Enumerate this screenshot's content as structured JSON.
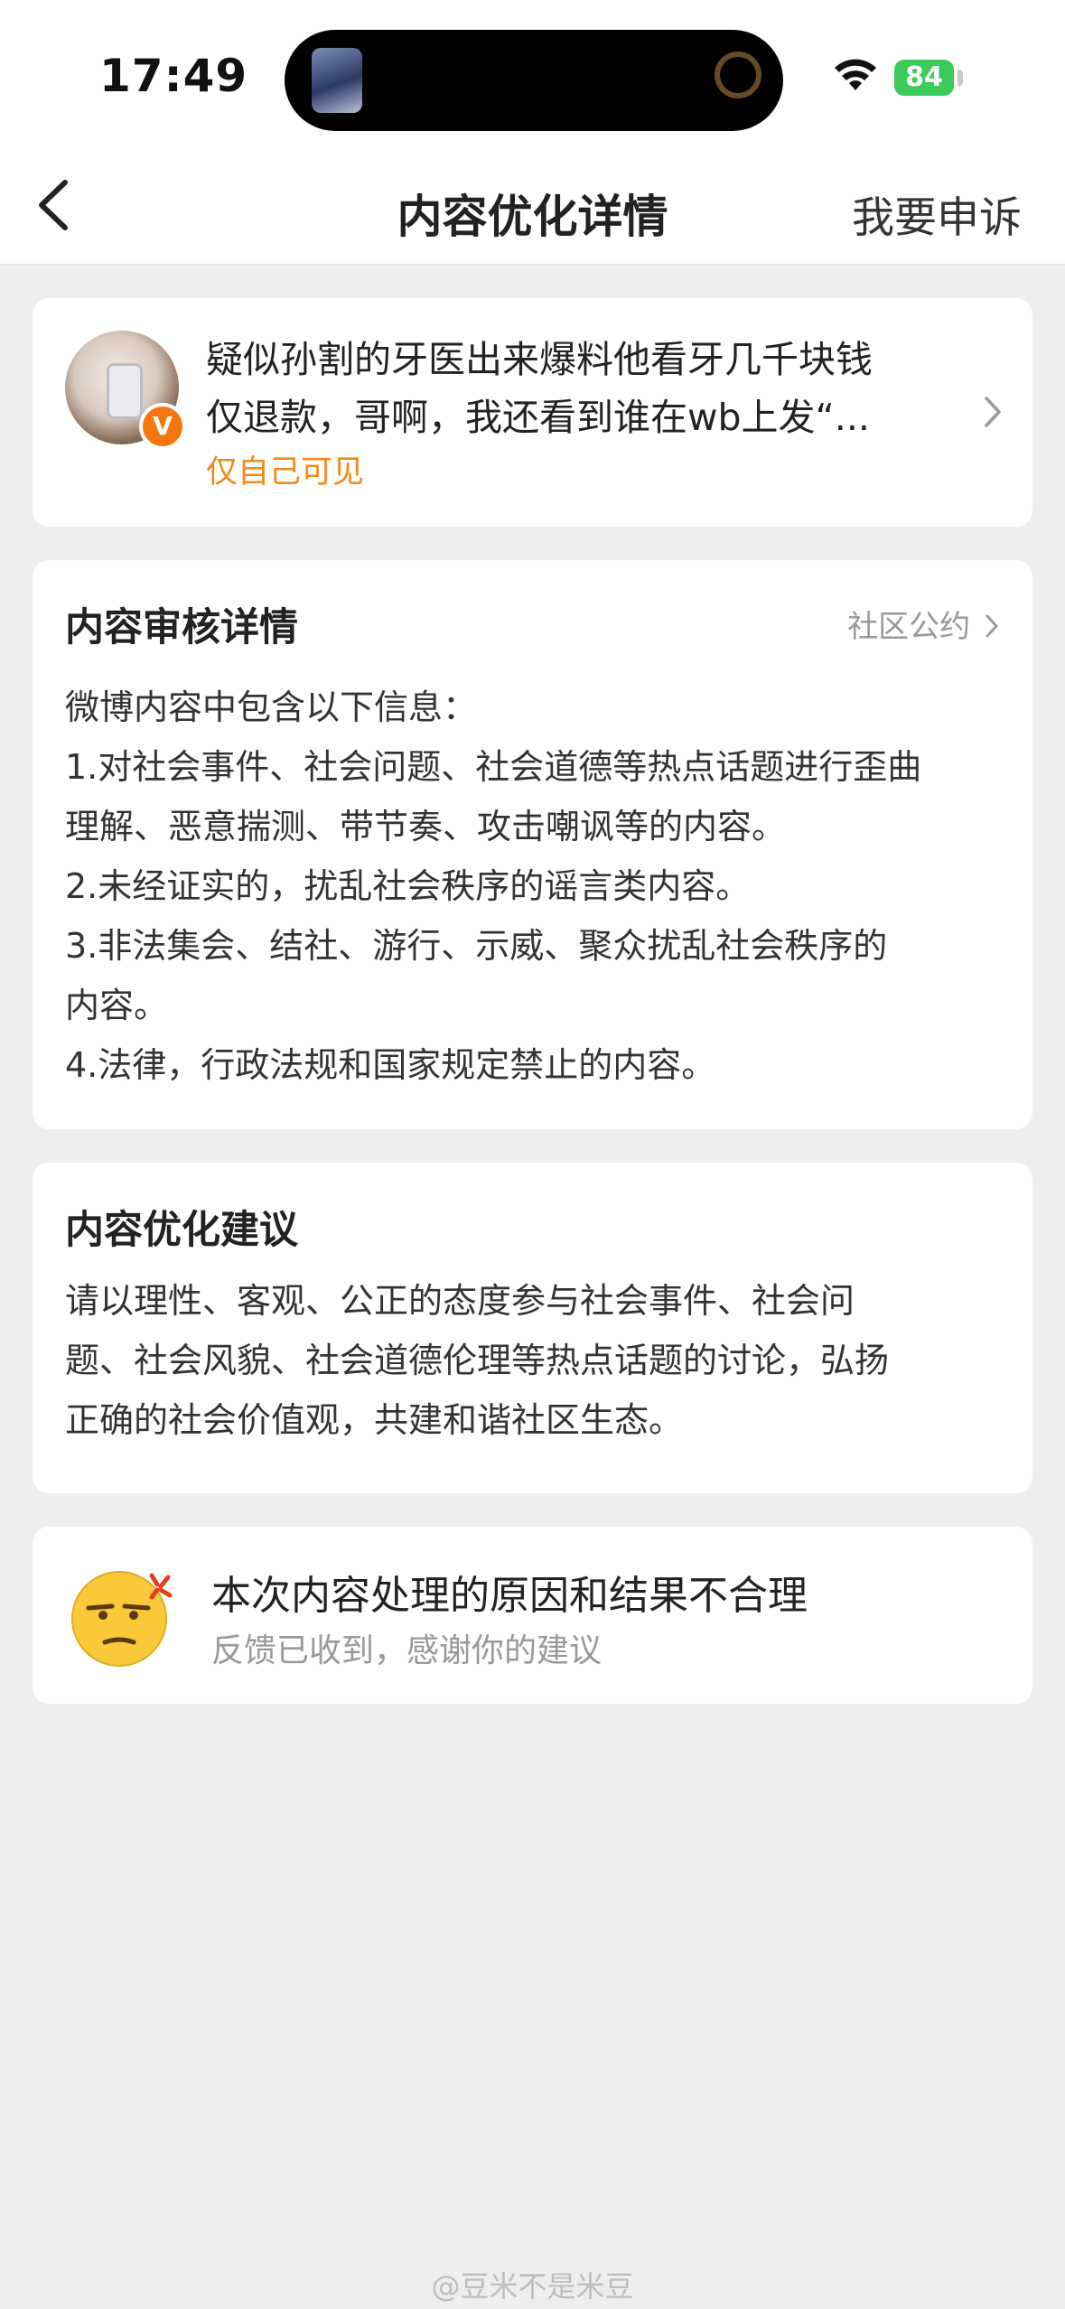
{
  "status_bar": {
    "time": "17:49",
    "battery": "84"
  },
  "nav": {
    "title": "内容优化详情",
    "appeal": "我要申诉"
  },
  "post": {
    "line1": "疑似孙割的牙医出来爆料他看牙几千块钱",
    "line2": "仅退款，哥啊，我还看到谁在wb上发“...",
    "visibility": "仅自己可见",
    "badge": "V"
  },
  "review": {
    "title": "内容审核详情",
    "rules_link": "社区公约",
    "lines": [
      "微博内容中包含以下信息：",
      "1.对社会事件、社会问题、社会道德等热点话题进行歪曲",
      "理解、恶意揣测、带节奏、攻击嘲讽等的内容。",
      "2.未经证实的，扰乱社会秩序的谣言类内容。",
      "3.非法集会、结社、游行、示威、聚众扰乱社会秩序的",
      "内容。",
      "4.法律，行政法规和国家规定禁止的内容。"
    ]
  },
  "advice": {
    "title": "内容优化建议",
    "lines": [
      "请以理性、客观、公正的态度参与社会事件、社会问",
      "题、社会风貌、社会道德伦理等热点话题的讨论，弘扬",
      "正确的社会价值观，共建和谐社区生态。"
    ]
  },
  "feedback": {
    "title": "本次内容处理的原因和结果不合理",
    "subtitle": "反馈已收到，感谢你的建议",
    "icon": "annoyed-face-icon"
  },
  "watermark": "@豆米不是米豆",
  "colors": {
    "accent_orange": "#f28a16",
    "battery_green": "#3dc957",
    "background": "#eeeef0"
  }
}
